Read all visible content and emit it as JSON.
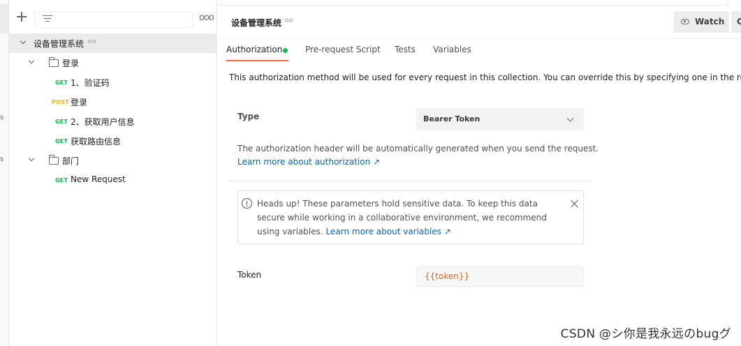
{
  "rail": {
    "fragments": [
      "s",
      "s"
    ]
  },
  "sidebar": {
    "more_label": "ooo",
    "collection": {
      "name": "设备管理系统"
    },
    "tree": [
      {
        "kind": "folder",
        "name": "登录"
      },
      {
        "kind": "request",
        "method": "GET",
        "name": "1、验证码"
      },
      {
        "kind": "request",
        "method": "POST",
        "name": "登录"
      },
      {
        "kind": "request",
        "method": "GET",
        "name": "2、获取用户信息"
      },
      {
        "kind": "request",
        "method": "GET",
        "name": "获取路由信息"
      },
      {
        "kind": "folder",
        "name": "部门"
      },
      {
        "kind": "request",
        "method": "GET",
        "name": "New Request"
      }
    ],
    "method_colors": {
      "GET": "#0cbb52",
      "POST": "#ffb400"
    }
  },
  "header": {
    "title": "设备管理系统",
    "watch_label": "Watch",
    "fork_label": "C"
  },
  "tabs": [
    {
      "label": "Authorization",
      "active": true,
      "status_dot_color": "#0cbb52"
    },
    {
      "label": "Pre-request Script",
      "active": false
    },
    {
      "label": "Tests",
      "active": false
    },
    {
      "label": "Variables",
      "active": false
    }
  ],
  "authorization": {
    "description": "This authorization method will be used for every request in this collection. You can override this by specifying one in the request.",
    "type_label": "Type",
    "type_value": "Bearer Token",
    "note": "The authorization header will be automatically generated when you send the request.",
    "learn_more": "Learn more about authorization ↗",
    "alert": {
      "text": "Heads up! These parameters hold sensitive data. To keep this data secure while working in a collaborative environment, we recommend using variables.",
      "link": "Learn more about variables ↗"
    },
    "token_label": "Token",
    "token_value": "{{token}}"
  },
  "watermark": "CSDN @シ你是我永远のbugグ",
  "colors": {
    "accent": "#f26b3a",
    "link": "#0265d2",
    "variable": "#e6621e"
  }
}
